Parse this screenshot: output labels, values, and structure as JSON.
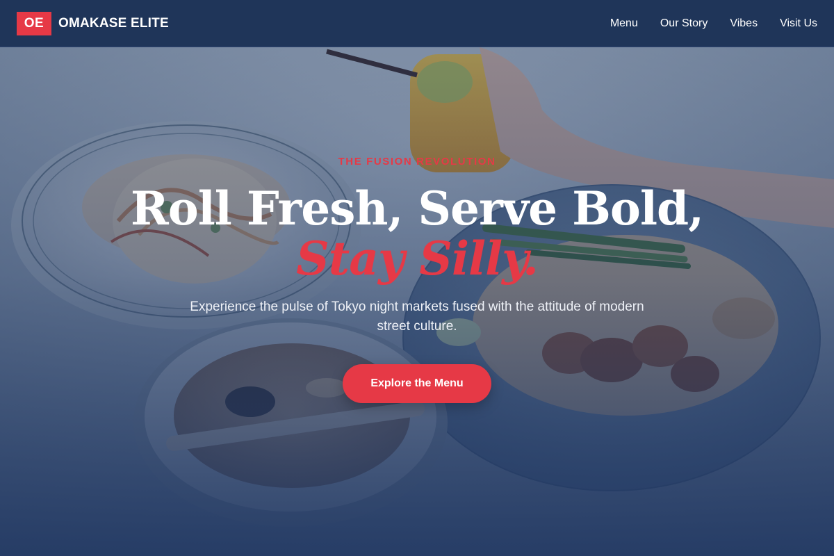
{
  "nav": {
    "logo_initials": "OE",
    "brand_name": "OMAKASE ELITE",
    "links": [
      {
        "label": "Menu"
      },
      {
        "label": "Our Story"
      },
      {
        "label": "Vibes"
      },
      {
        "label": "Visit Us"
      }
    ]
  },
  "hero": {
    "eyebrow": "THE FUSION REVOLUTION",
    "headline": "Roll Fresh, Serve Bold,",
    "headline_accent": "Stay Silly.",
    "subtitle": "Experience the pulse of Tokyo night markets fused with the attitude of modern street culture.",
    "cta_label": "Explore the Menu"
  },
  "colors": {
    "navy": "#1f3559",
    "accent_red": "#e63946",
    "white": "#ffffff"
  }
}
